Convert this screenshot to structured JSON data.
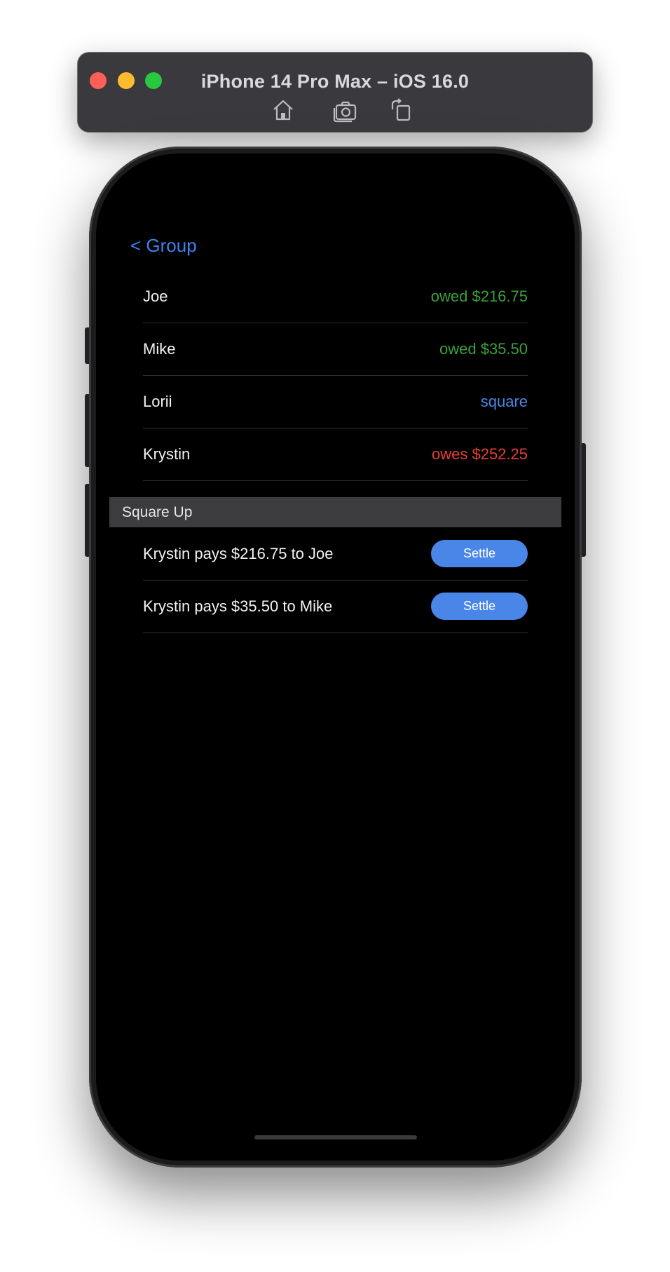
{
  "simulator": {
    "title": "iPhone 14 Pro Max – iOS 16.0",
    "toolbar": [
      {
        "icon": "home-icon"
      },
      {
        "icon": "screenshot-icon"
      },
      {
        "icon": "rotate-icon"
      }
    ]
  },
  "nav": {
    "back_label": "< Group"
  },
  "balances": [
    {
      "name": "Joe",
      "status": "owed $216.75",
      "status_type": "owed"
    },
    {
      "name": "Mike",
      "status": "owed $35.50",
      "status_type": "owed"
    },
    {
      "name": "Lorii",
      "status": "square",
      "status_type": "square"
    },
    {
      "name": "Krystin",
      "status": "owes $252.25",
      "status_type": "owes"
    }
  ],
  "square_up": {
    "header": "Square Up",
    "payments": [
      {
        "text": "Krystin pays $216.75 to Joe",
        "button": "Settle"
      },
      {
        "text": "Krystin pays $35.50 to Mike",
        "button": "Settle"
      }
    ]
  },
  "colors": {
    "accent": "#4a86e8",
    "owed": "#3aa13a",
    "owes": "#ea3d35",
    "background": "#000000"
  }
}
